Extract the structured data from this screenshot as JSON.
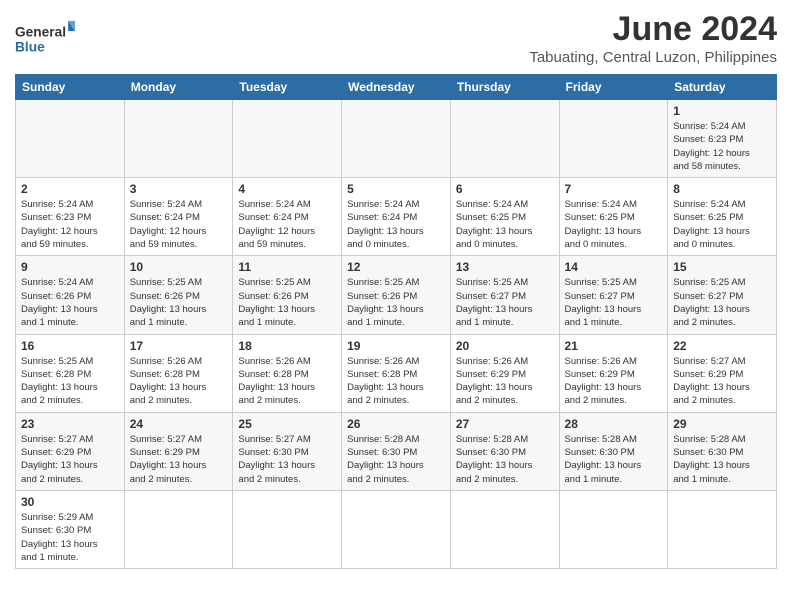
{
  "logo": {
    "line1": "General",
    "line2": "Blue"
  },
  "title": "June 2024",
  "location": "Tabuating, Central Luzon, Philippines",
  "days_of_week": [
    "Sunday",
    "Monday",
    "Tuesday",
    "Wednesday",
    "Thursday",
    "Friday",
    "Saturday"
  ],
  "weeks": [
    [
      {
        "day": "",
        "info": ""
      },
      {
        "day": "",
        "info": ""
      },
      {
        "day": "",
        "info": ""
      },
      {
        "day": "",
        "info": ""
      },
      {
        "day": "",
        "info": ""
      },
      {
        "day": "",
        "info": ""
      },
      {
        "day": "1",
        "info": "Sunrise: 5:24 AM\nSunset: 6:23 PM\nDaylight: 12 hours\nand 58 minutes."
      }
    ],
    [
      {
        "day": "2",
        "info": "Sunrise: 5:24 AM\nSunset: 6:23 PM\nDaylight: 12 hours\nand 59 minutes."
      },
      {
        "day": "3",
        "info": "Sunrise: 5:24 AM\nSunset: 6:24 PM\nDaylight: 12 hours\nand 59 minutes."
      },
      {
        "day": "4",
        "info": "Sunrise: 5:24 AM\nSunset: 6:24 PM\nDaylight: 12 hours\nand 59 minutes."
      },
      {
        "day": "5",
        "info": "Sunrise: 5:24 AM\nSunset: 6:24 PM\nDaylight: 13 hours\nand 0 minutes."
      },
      {
        "day": "6",
        "info": "Sunrise: 5:24 AM\nSunset: 6:25 PM\nDaylight: 13 hours\nand 0 minutes."
      },
      {
        "day": "7",
        "info": "Sunrise: 5:24 AM\nSunset: 6:25 PM\nDaylight: 13 hours\nand 0 minutes."
      },
      {
        "day": "8",
        "info": "Sunrise: 5:24 AM\nSunset: 6:25 PM\nDaylight: 13 hours\nand 0 minutes."
      }
    ],
    [
      {
        "day": "9",
        "info": "Sunrise: 5:24 AM\nSunset: 6:26 PM\nDaylight: 13 hours\nand 1 minute."
      },
      {
        "day": "10",
        "info": "Sunrise: 5:25 AM\nSunset: 6:26 PM\nDaylight: 13 hours\nand 1 minute."
      },
      {
        "day": "11",
        "info": "Sunrise: 5:25 AM\nSunset: 6:26 PM\nDaylight: 13 hours\nand 1 minute."
      },
      {
        "day": "12",
        "info": "Sunrise: 5:25 AM\nSunset: 6:26 PM\nDaylight: 13 hours\nand 1 minute."
      },
      {
        "day": "13",
        "info": "Sunrise: 5:25 AM\nSunset: 6:27 PM\nDaylight: 13 hours\nand 1 minute."
      },
      {
        "day": "14",
        "info": "Sunrise: 5:25 AM\nSunset: 6:27 PM\nDaylight: 13 hours\nand 1 minute."
      },
      {
        "day": "15",
        "info": "Sunrise: 5:25 AM\nSunset: 6:27 PM\nDaylight: 13 hours\nand 2 minutes."
      }
    ],
    [
      {
        "day": "16",
        "info": "Sunrise: 5:25 AM\nSunset: 6:28 PM\nDaylight: 13 hours\nand 2 minutes."
      },
      {
        "day": "17",
        "info": "Sunrise: 5:26 AM\nSunset: 6:28 PM\nDaylight: 13 hours\nand 2 minutes."
      },
      {
        "day": "18",
        "info": "Sunrise: 5:26 AM\nSunset: 6:28 PM\nDaylight: 13 hours\nand 2 minutes."
      },
      {
        "day": "19",
        "info": "Sunrise: 5:26 AM\nSunset: 6:28 PM\nDaylight: 13 hours\nand 2 minutes."
      },
      {
        "day": "20",
        "info": "Sunrise: 5:26 AM\nSunset: 6:29 PM\nDaylight: 13 hours\nand 2 minutes."
      },
      {
        "day": "21",
        "info": "Sunrise: 5:26 AM\nSunset: 6:29 PM\nDaylight: 13 hours\nand 2 minutes."
      },
      {
        "day": "22",
        "info": "Sunrise: 5:27 AM\nSunset: 6:29 PM\nDaylight: 13 hours\nand 2 minutes."
      }
    ],
    [
      {
        "day": "23",
        "info": "Sunrise: 5:27 AM\nSunset: 6:29 PM\nDaylight: 13 hours\nand 2 minutes."
      },
      {
        "day": "24",
        "info": "Sunrise: 5:27 AM\nSunset: 6:29 PM\nDaylight: 13 hours\nand 2 minutes."
      },
      {
        "day": "25",
        "info": "Sunrise: 5:27 AM\nSunset: 6:30 PM\nDaylight: 13 hours\nand 2 minutes."
      },
      {
        "day": "26",
        "info": "Sunrise: 5:28 AM\nSunset: 6:30 PM\nDaylight: 13 hours\nand 2 minutes."
      },
      {
        "day": "27",
        "info": "Sunrise: 5:28 AM\nSunset: 6:30 PM\nDaylight: 13 hours\nand 2 minutes."
      },
      {
        "day": "28",
        "info": "Sunrise: 5:28 AM\nSunset: 6:30 PM\nDaylight: 13 hours\nand 1 minute."
      },
      {
        "day": "29",
        "info": "Sunrise: 5:28 AM\nSunset: 6:30 PM\nDaylight: 13 hours\nand 1 minute."
      }
    ],
    [
      {
        "day": "30",
        "info": "Sunrise: 5:29 AM\nSunset: 6:30 PM\nDaylight: 13 hours\nand 1 minute."
      },
      {
        "day": "",
        "info": ""
      },
      {
        "day": "",
        "info": ""
      },
      {
        "day": "",
        "info": ""
      },
      {
        "day": "",
        "info": ""
      },
      {
        "day": "",
        "info": ""
      },
      {
        "day": "",
        "info": ""
      }
    ]
  ]
}
